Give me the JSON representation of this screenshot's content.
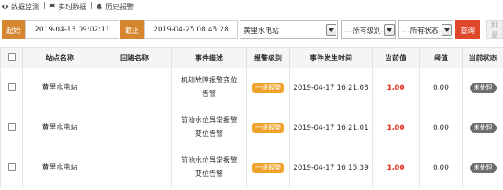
{
  "breadcrumb": [
    {
      "label": "数据监测",
      "icon": "eye-icon"
    },
    {
      "label": "实时数据",
      "icon": "flag-icon"
    },
    {
      "label": "历史报警",
      "icon": "bell-icon"
    }
  ],
  "filters": {
    "start_label": "起始",
    "start_value": "2019-04-13 09:02:11",
    "end_label": "截止",
    "end_value": "2019-04-25 08:45:28",
    "station_value": "黄里水电站",
    "level_value": "---所有级别---",
    "status_value": "---所有状态---",
    "query_label": "查询",
    "batch_label": "批量"
  },
  "table": {
    "headers": [
      "站点名称",
      "回路名称",
      "事件描述",
      "报警级别",
      "事件发生时间",
      "当前值",
      "阈值",
      "当前状态"
    ],
    "rows": [
      {
        "station": "黄里水电站",
        "loop": "",
        "desc": "机频故障报警变位告警",
        "level": "一级报警",
        "time": "2019-04-17 16:21:03",
        "current": "1.00",
        "threshold": "0.00",
        "status": "未处理"
      },
      {
        "station": "黄里水电站",
        "loop": "",
        "desc": "前池水位异常报警变位告警",
        "level": "一级报警",
        "time": "2019-04-17 16:21:01",
        "current": "1.00",
        "threshold": "0.00",
        "status": "未处理"
      },
      {
        "station": "黄里水电站",
        "loop": "",
        "desc": "前池水位异常报警变位告警",
        "level": "一级报警",
        "time": "2019-04-17 16:15:39",
        "current": "1.00",
        "threshold": "0.00",
        "status": "未处理"
      }
    ]
  },
  "colors": {
    "label_bg": "#d6862f",
    "query_bg": "#e0482b",
    "level_badge": "#f0a32c",
    "status_badge": "#6d6d6d",
    "current_value": "#e0301e"
  }
}
